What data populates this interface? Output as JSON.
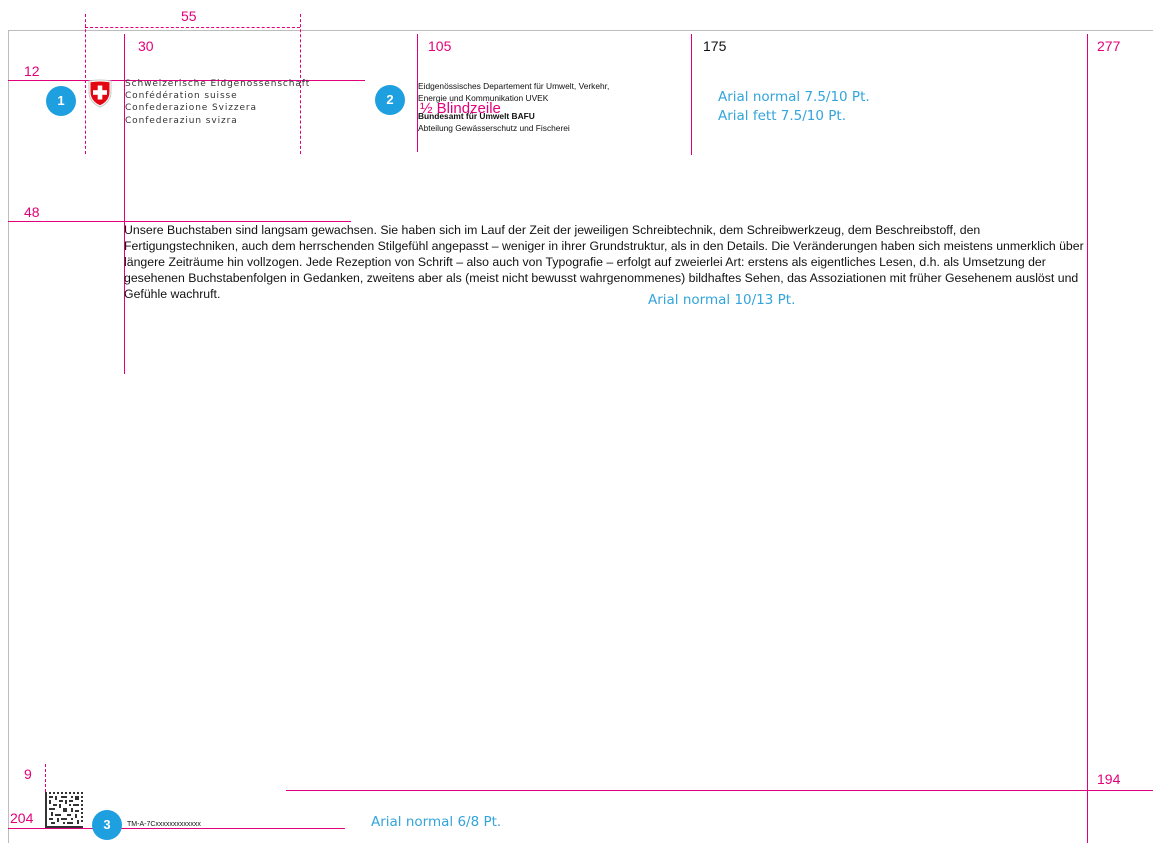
{
  "guides": {
    "top_width": "55",
    "col_30": "30",
    "col_105": "105",
    "col_175": "175",
    "col_277": "277",
    "row_12": "12",
    "row_48": "48",
    "row_9": "9",
    "row_204": "204",
    "row_194": "194"
  },
  "badges": {
    "one": "1",
    "two": "2",
    "three": "3"
  },
  "confederation": {
    "line1": "Schweizerische Eidgenossenschaft",
    "line2": "Confédération suisse",
    "line3": "Confederazione Svizzera",
    "line4": "Confederaziun svizra"
  },
  "department": {
    "line1": "Eidgenössisches Departement für Umwelt, Verkehr,",
    "line2": "Energie und Kommunikation UVEK",
    "office": "Bundesamt für Umwelt BAFU",
    "division": "Abteilung Gewässerschutz und Fischerei"
  },
  "blind_line": "½ Blindzeile",
  "notes": {
    "header_normal": "Arial normal 7.5/10 Pt.",
    "header_bold": "Arial fett 7.5/10 Pt.",
    "body": "Arial normal 10/13 Pt.",
    "footer": "Arial normal 6/8 Pt."
  },
  "body_text": "Unsere Buchstaben sind langsam gewachsen. Sie haben sich im Lauf der Zeit der jeweiligen Schreibtechnik, dem Schreibwerkzeug, dem Beschreibstoff, den Fertigungstechniken, auch dem herrschenden Stilgefühl angepasst – weniger in ihrer Grundstruktur, als in den Details. Die Veränderungen haben sich meistens unmerklich über längere Zeiträume hin vollzogen. Jede Rezeption von Schrift – also auch von Typografie – erfolgt auf zweierlei Art: erstens als eigentliches Lesen, d.h. als Umsetzung der gesehenen Buchstabenfolgen in Gedanken, zweitens aber als (meist nicht bewusst wahrgenommenes) bildhaftes Sehen, das Assoziationen mit früher Gesehenem auslöst und Gefühle wachruft.",
  "footer_code": "TM-A-7Cxxxxxxxxxxxxx",
  "colors": {
    "guide": "#e2007a",
    "note": "#33a4dc",
    "badge": "#1e9fe0",
    "swiss_red": "#e30613"
  },
  "icons": {
    "coat_of_arms": "swiss-cross-shield-icon",
    "datamatrix": "datamatrix-code-icon"
  }
}
